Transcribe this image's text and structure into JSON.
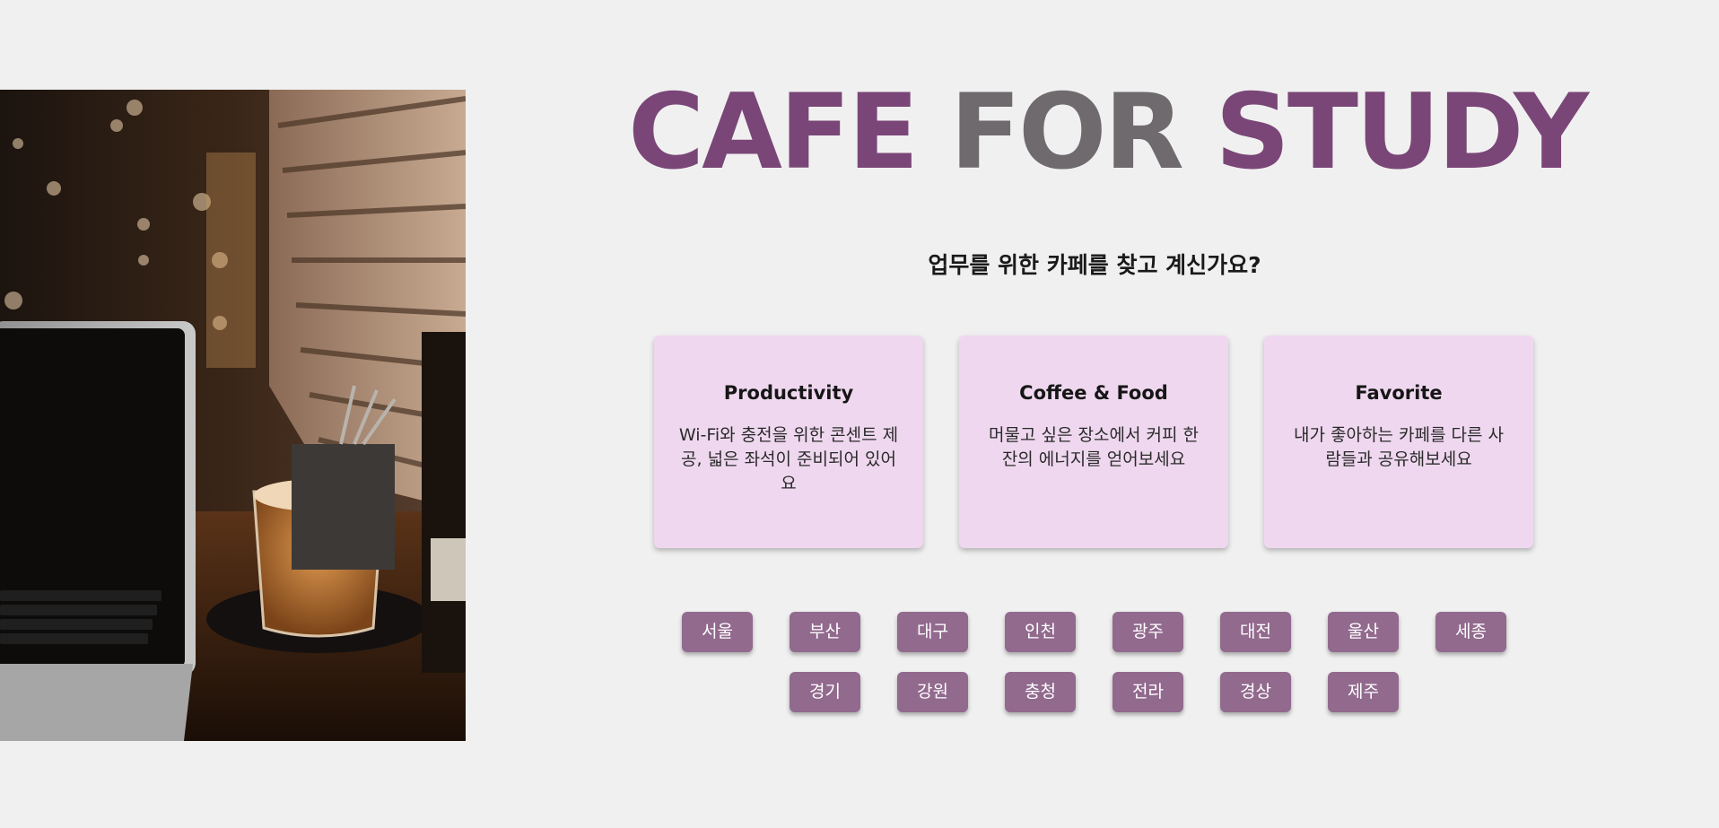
{
  "header": {
    "title_part1": "CAFE",
    "title_part2": "FOR",
    "title_part3": "STUDY",
    "subtitle": "업무를 위한 카페를 찾고 계신가요?"
  },
  "features": [
    {
      "title": "Productivity",
      "description": "Wi-Fi와 충전을 위한 콘센트 제공, 넓은 좌석이 준비되어 있어요"
    },
    {
      "title": "Coffee & Food",
      "description": "머물고 싶은 장소에서 커피 한잔의 에너지를 얻어보세요"
    },
    {
      "title": "Favorite",
      "description": "내가 좋아하는 카페를 다른 사람들과 공유해보세요"
    }
  ],
  "regions": [
    "서울",
    "부산",
    "대구",
    "인천",
    "광주",
    "대전",
    "울산",
    "세종",
    "경기",
    "강원",
    "충청",
    "전라",
    "경상",
    "제주"
  ],
  "colors": {
    "accent": "#7a4677",
    "muted_title": "#6e6a6e",
    "card_background": "#efd8ef",
    "region_button": "#926a8e",
    "page_background": "#f0f0f0"
  }
}
